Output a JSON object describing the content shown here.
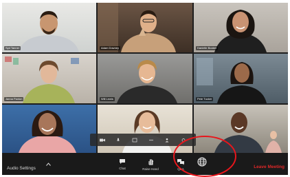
{
  "participants": [
    {
      "name": "Syd Tanner"
    },
    {
      "name": "Adam Downey"
    },
    {
      "name": "Danielle Booker"
    },
    {
      "name": "Janna Paxton"
    },
    {
      "name": "Will Lewis"
    },
    {
      "name": "Pete Tucker"
    },
    {
      "name": ""
    },
    {
      "name": ""
    },
    {
      "name": ""
    }
  ],
  "toolbar": {
    "audio_settings": "Audio Settings",
    "chat": "Chat",
    "raise_hand": "Raise Hand",
    "qa": "Q&A",
    "leave": "Leave Meeting"
  },
  "colors": {
    "leave": "#e02828",
    "highlight": "#e8161c",
    "toolbar_bg": "#1a1a1a"
  },
  "icons": {
    "audio_caret": "chevron-up-icon",
    "chat": "chat-bubble-icon",
    "raise_hand": "hand-icon",
    "qa": "qa-bubbles-icon",
    "interpretation": "globe-icon"
  }
}
